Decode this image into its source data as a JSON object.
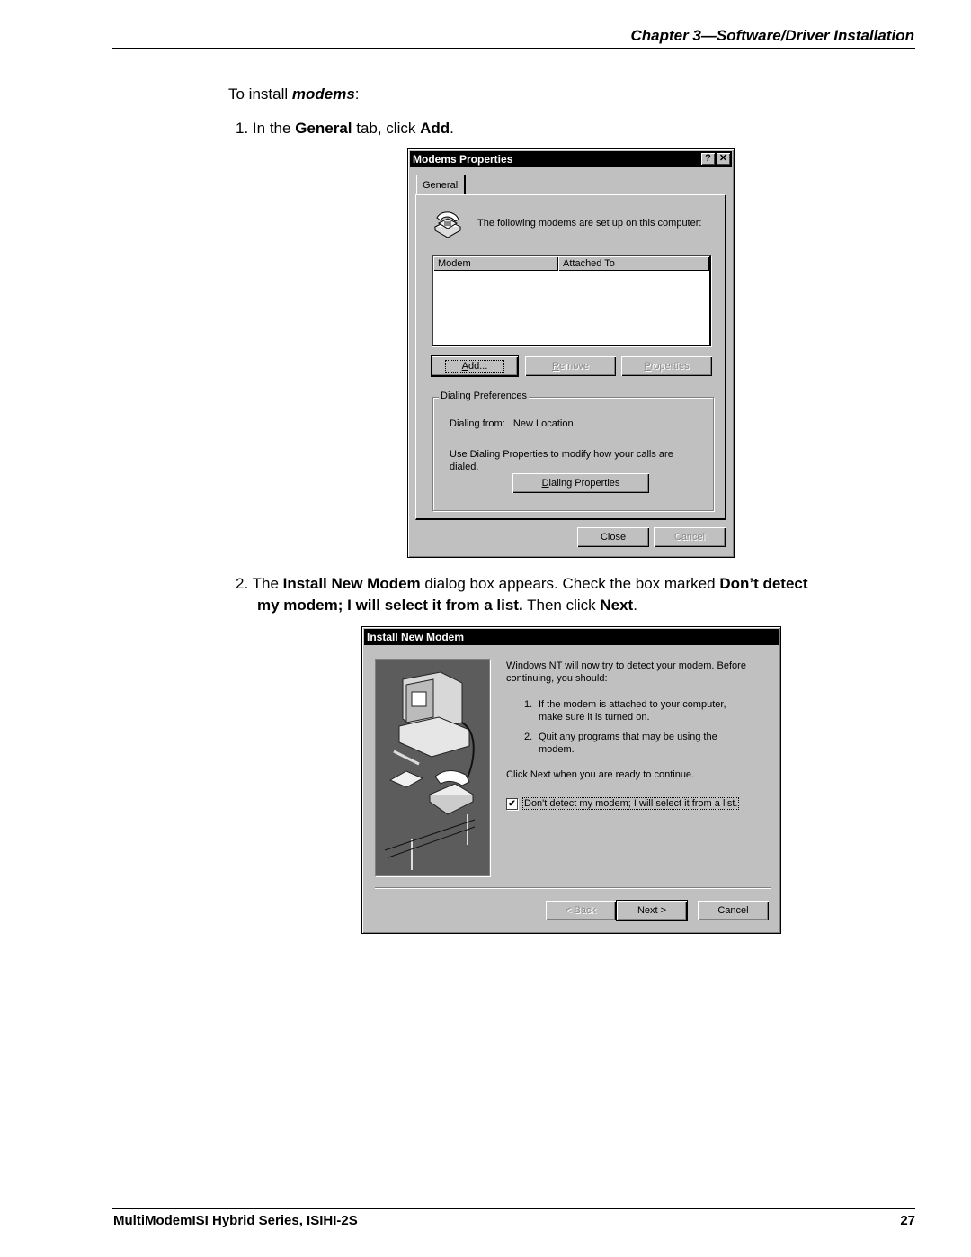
{
  "page": {
    "header_title": "Chapter 3—Software/Driver Installation",
    "intro_prefix": "To install ",
    "intro_emphasis": "modems",
    "intro_suffix": ":",
    "step1": {
      "number": "1.",
      "parts": [
        "In the ",
        "General",
        " tab, click ",
        "Add",
        "."
      ]
    },
    "step2": {
      "number": "2.",
      "parts": [
        "The ",
        "Install New Modem",
        " dialog box appears. Check the box marked ",
        "Don’t detect",
        "my modem; I will select it from a list.",
        " Then click ",
        "Next",
        "."
      ]
    },
    "footer_left": "MultiModemISI Hybrid Series, ISIHI-2S",
    "footer_right": "27"
  },
  "modems_dialog": {
    "title": "Modems Properties",
    "help_button": "?",
    "close_button": "✕",
    "tab_label": "General",
    "intro_text": "The following modems are set up on this computer:",
    "icon": "telephone-icon",
    "list_columns": [
      "Modem",
      "Attached To"
    ],
    "list_rows": [],
    "add_button": {
      "label": "Add...",
      "accel": "A",
      "enabled": true
    },
    "remove_button": {
      "label": "Remove",
      "accel": "R",
      "enabled": false
    },
    "properties_button": {
      "label": "Properties",
      "accel": "P",
      "enabled": false
    },
    "group_label": "Dialing Preferences",
    "dialing_from_label": "Dialing from:",
    "dialing_from_value": "New Location",
    "dialing_help": "Use Dialing Properties to modify how your calls are dialed.",
    "dialing_properties_button": {
      "label": "Dialing Properties",
      "accel": "D",
      "enabled": true
    },
    "close_btn": {
      "label": "Close",
      "enabled": true
    },
    "cancel_btn": {
      "label": "Cancel",
      "enabled": false
    }
  },
  "install_dialog": {
    "title": "Install New Modem",
    "illustration": "computer-modem-phone-illustration",
    "intro_text": "Windows NT will now try to detect your modem.  Before continuing, you should:",
    "items": [
      {
        "num": "1.",
        "text": "If the modem is attached to your computer, make sure it is turned on."
      },
      {
        "num": "2.",
        "text": "Quit any programs that may be using the modem."
      }
    ],
    "continue_text": "Click Next when you are ready to continue.",
    "checkbox": {
      "label": "Don't detect my modem; I will select it from a list.",
      "checked": true,
      "check_glyph": "✔"
    },
    "back_button": {
      "label": "< Back",
      "enabled": false
    },
    "next_button": {
      "label": "Next >",
      "enabled": true
    },
    "cancel_button": {
      "label": "Cancel",
      "enabled": true
    }
  }
}
